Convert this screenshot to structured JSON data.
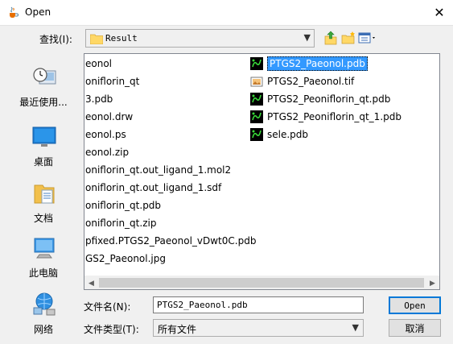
{
  "window": {
    "title": "Open",
    "icon": "java-cup-icon",
    "close_glyph": "✕"
  },
  "toolbar": {
    "look_in_label": "查找(I):",
    "look_in_value": "Result",
    "up_icon": "up-folder-icon",
    "new_folder_icon": "new-folder-icon",
    "view_icon": "view-menu-icon"
  },
  "places": [
    {
      "label": "最近使用...",
      "icon": "recent-items-icon"
    },
    {
      "label": "桌面",
      "icon": "desktop-icon"
    },
    {
      "label": "文档",
      "icon": "documents-icon"
    },
    {
      "label": "此电脑",
      "icon": "this-pc-icon"
    },
    {
      "label": "网络",
      "icon": "network-icon"
    }
  ],
  "files_col1": [
    "eonol",
    "oniflorin_qt",
    "3.pdb",
    "eonol.drw",
    "eonol.ps",
    "eonol.zip",
    "oniflorin_qt.out_ligand_1.mol2",
    "oniflorin_qt.out_ligand_1.sdf",
    "oniflorin_qt.pdb",
    "oniflorin_qt.zip",
    "pfixed.PTGS2_Paeonol_vDwt0C.pdb",
    "GS2_Paeonol.jpg"
  ],
  "files_col2": [
    {
      "name": "PTGS2_Paeonol.pdb",
      "icon": "pdb-file-icon",
      "selected": true
    },
    {
      "name": "PTGS2_Paeonol.tif",
      "icon": "image-file-icon",
      "selected": false
    },
    {
      "name": "PTGS2_Peoniflorin_qt.pdb",
      "icon": "pdb-file-icon",
      "selected": false
    },
    {
      "name": "PTGS2_Peoniflorin_qt_1.pdb",
      "icon": "pdb-file-icon",
      "selected": false
    },
    {
      "name": "sele.pdb",
      "icon": "pdb-file-icon",
      "selected": false
    }
  ],
  "form": {
    "file_name_label": "文件名(N):",
    "file_name_value": "PTGS2_Paeonol.pdb",
    "file_type_label": "文件类型(T):",
    "file_type_value": "所有文件"
  },
  "buttons": {
    "open": "Open",
    "cancel": "取消"
  },
  "colors": {
    "selection": "#3399ff",
    "dialog_bg": "#f0f0f0",
    "default_button_border": "#0078d7"
  }
}
